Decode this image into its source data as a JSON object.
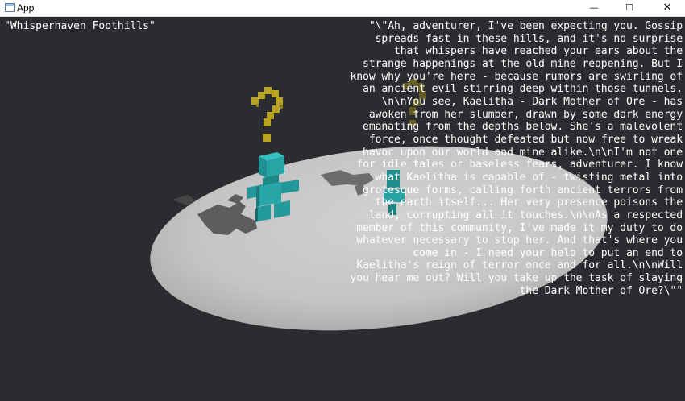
{
  "window": {
    "title": "App",
    "minimize_glyph": "—",
    "maximize_glyph": "☐",
    "close_glyph": "✕"
  },
  "scene": {
    "location": "\"Whisperhaven Foothills\"",
    "quest_marker_icon": "question-mark",
    "npc_color": "#27a2a3",
    "marker_color": "#b8a420",
    "ground_color": "#c9c9c9",
    "background_color": "#2b2c2f"
  },
  "dialogue": {
    "lines": [
      "\"\\\"Ah, adventurer, I've been expecting you. Gossip",
      "spreads fast in these hills, and it's no surprise",
      "that whispers have reached your ears about the",
      "strange happenings at the old mine reopening. But I",
      "know why you're here - because rumors are swirling of",
      "an ancient evil stirring deep within those tunnels.",
      "\\n\\nYou see, Kaelitha - Dark Mother of Ore - has",
      "awoken from her slumber, drawn by some dark energy",
      "emanating from the depths below. She's a malevolent",
      "force, once thought defeated but now free to wreak",
      "havoc upon our world and mine alike.\\n\\nI'm not one",
      "for idle tales or baseless fears, adventurer. I know",
      "what Kaelitha is capable of - twisting metal into",
      "grotesque forms, calling forth ancient terrors from",
      "the earth itself... Her very presence poisons the",
      "land, corrupting all it touches.\\n\\nAs a respected",
      "member of this community, I've made it my duty to do",
      "whatever necessary to stop her. And that's where you",
      "come in - I need your help to put an end to",
      "Kaelitha's reign of terror once and for all.\\n\\nWill",
      "you hear me out? Will you take up the task of slaying",
      "the Dark Mother of Ore?\\\"\""
    ]
  }
}
